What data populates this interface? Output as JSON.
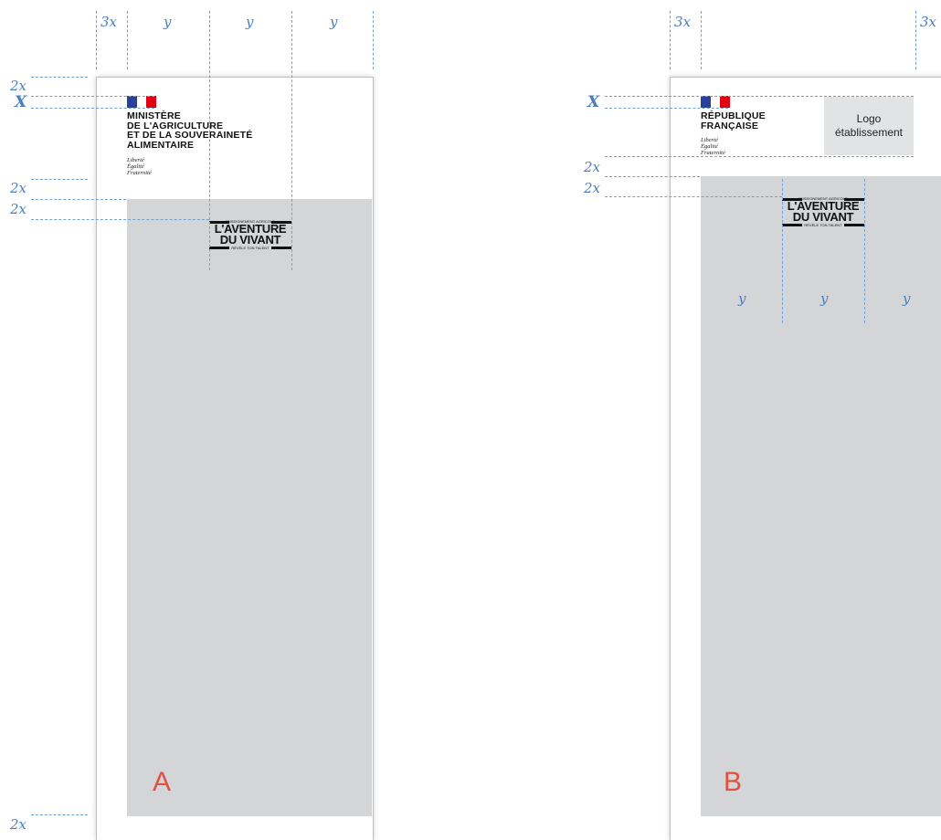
{
  "colors": {
    "guide": "#6fa3d8",
    "dimension_text": "#4a7fbf",
    "placeholder_grey": "#d4d5d7",
    "letter": "#e0513f",
    "flag_blue": "#2b3f9c",
    "flag_red": "#e1000f"
  },
  "labels": {
    "x_bold": "X",
    "two_x": "2x",
    "three_x": "3x",
    "y": "y"
  },
  "panel_a": {
    "flag_icon": "marianne-flag-icon",
    "org_lines": [
      "MINISTÈRE",
      "DE L'AGRICULTURE",
      "ET DE LA SOUVERAINETÉ",
      "ALIMENTAIRE"
    ],
    "motto": [
      "Liberté",
      "Égalité",
      "Fraternité"
    ],
    "letter": "A"
  },
  "panel_b": {
    "flag_icon": "marianne-flag-icon",
    "org_lines": [
      "RÉPUBLIQUE",
      "FRANÇAISE"
    ],
    "motto": [
      "Liberté",
      "Égalité",
      "Fraternité"
    ],
    "logo_box": [
      "Logo",
      "établissement"
    ],
    "letter": "B"
  },
  "aventure_logo": {
    "top": "ENSEIGNEMENT AGRICOLE",
    "line1": "L'AVENTURE",
    "line2": "DU VIVANT",
    "bottom": "RÉVÈLE TON TALENT"
  }
}
